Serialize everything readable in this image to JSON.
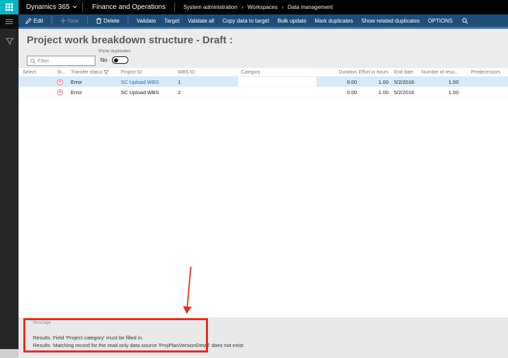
{
  "topbar": {
    "app_label": "Dynamics 365",
    "product_name": "Finance and Operations",
    "breadcrumb": [
      "System administration",
      "Workspaces",
      "Data management"
    ],
    "breadcrumb_separator": "›"
  },
  "toolbar": {
    "items": [
      {
        "label": "Edit",
        "icon": "pencil-icon",
        "disabled": false,
        "separator_after": true
      },
      {
        "label": "New",
        "icon": "plus-icon",
        "disabled": true,
        "separator_after": true
      },
      {
        "label": "Delete",
        "icon": "trash-icon",
        "disabled": false,
        "separator_after": true
      },
      {
        "label": "Validate"
      },
      {
        "label": "Target"
      },
      {
        "label": "Validate all"
      },
      {
        "label": "Copy data to target"
      },
      {
        "label": "Bulk update"
      },
      {
        "label": "Mark duplicates"
      },
      {
        "label": "Show related duplicates"
      },
      {
        "label": "OPTIONS"
      }
    ],
    "search_icon": "search-icon"
  },
  "page": {
    "title": "Project work breakdown structure - Draft :"
  },
  "filters": {
    "filter_placeholder": "Filter",
    "show_duplicates_label": "Show duplicates",
    "toggle_value": "No",
    "toggle_state": "off"
  },
  "grid": {
    "columns": [
      {
        "key": "select",
        "label": "Select"
      },
      {
        "key": "status_icon",
        "label": "St..."
      },
      {
        "key": "transfer_status",
        "label": "Transfer status",
        "filter_icon": true
      },
      {
        "key": "project_id",
        "label": "Project ID"
      },
      {
        "key": "wbs_id",
        "label": "WBS ID"
      },
      {
        "key": "category",
        "label": "Category"
      },
      {
        "key": "duration",
        "label": "Duration",
        "align": "right"
      },
      {
        "key": "effort_in_hours",
        "label": "Effort in hours",
        "align": "right"
      },
      {
        "key": "end_date",
        "label": "End date"
      },
      {
        "key": "number_of_resources",
        "label": "Number of reso...",
        "align": "right",
        "overflow": true
      },
      {
        "key": "predecessors",
        "label": "Predecessors",
        "pad": true
      }
    ],
    "rows": [
      {
        "select": "",
        "status": "error",
        "transfer_status": "Error",
        "project_id": "SC Upload WBS",
        "project_id_link": true,
        "wbs_id": "1",
        "category": "",
        "duration": "0.00",
        "effort_in_hours": "1.00",
        "end_date": "5/2/2016",
        "number_of_resources": "1.00",
        "predecessors": "",
        "selected": true
      },
      {
        "select": "",
        "status": "error",
        "transfer_status": "Error",
        "project_id": "SC Upload WBS",
        "project_id_link": false,
        "wbs_id": "2",
        "category": "",
        "duration": "0.00",
        "effort_in_hours": "1.00",
        "end_date": "5/2/2016",
        "number_of_resources": "1.00",
        "predecessors": "",
        "selected": false
      }
    ]
  },
  "message_panel": {
    "label": "Message",
    "lines": [
      "Results. Field 'Project category' must be filled in.",
      "Results. Matching record for the read only data source 'ProjPlanVersionDetail' does not exist"
    ]
  },
  "colors": {
    "brand_teal": "#00b7c3",
    "toolbar_blue": "#1d4e79",
    "row_highlight": "#d8eaf8",
    "link_blue": "#2970b8",
    "error_red": "#d5353d",
    "annotation_red": "#e0301e"
  },
  "annotation": {
    "type": "red box with arrow pointing at message panel",
    "color": "#e0301e"
  }
}
